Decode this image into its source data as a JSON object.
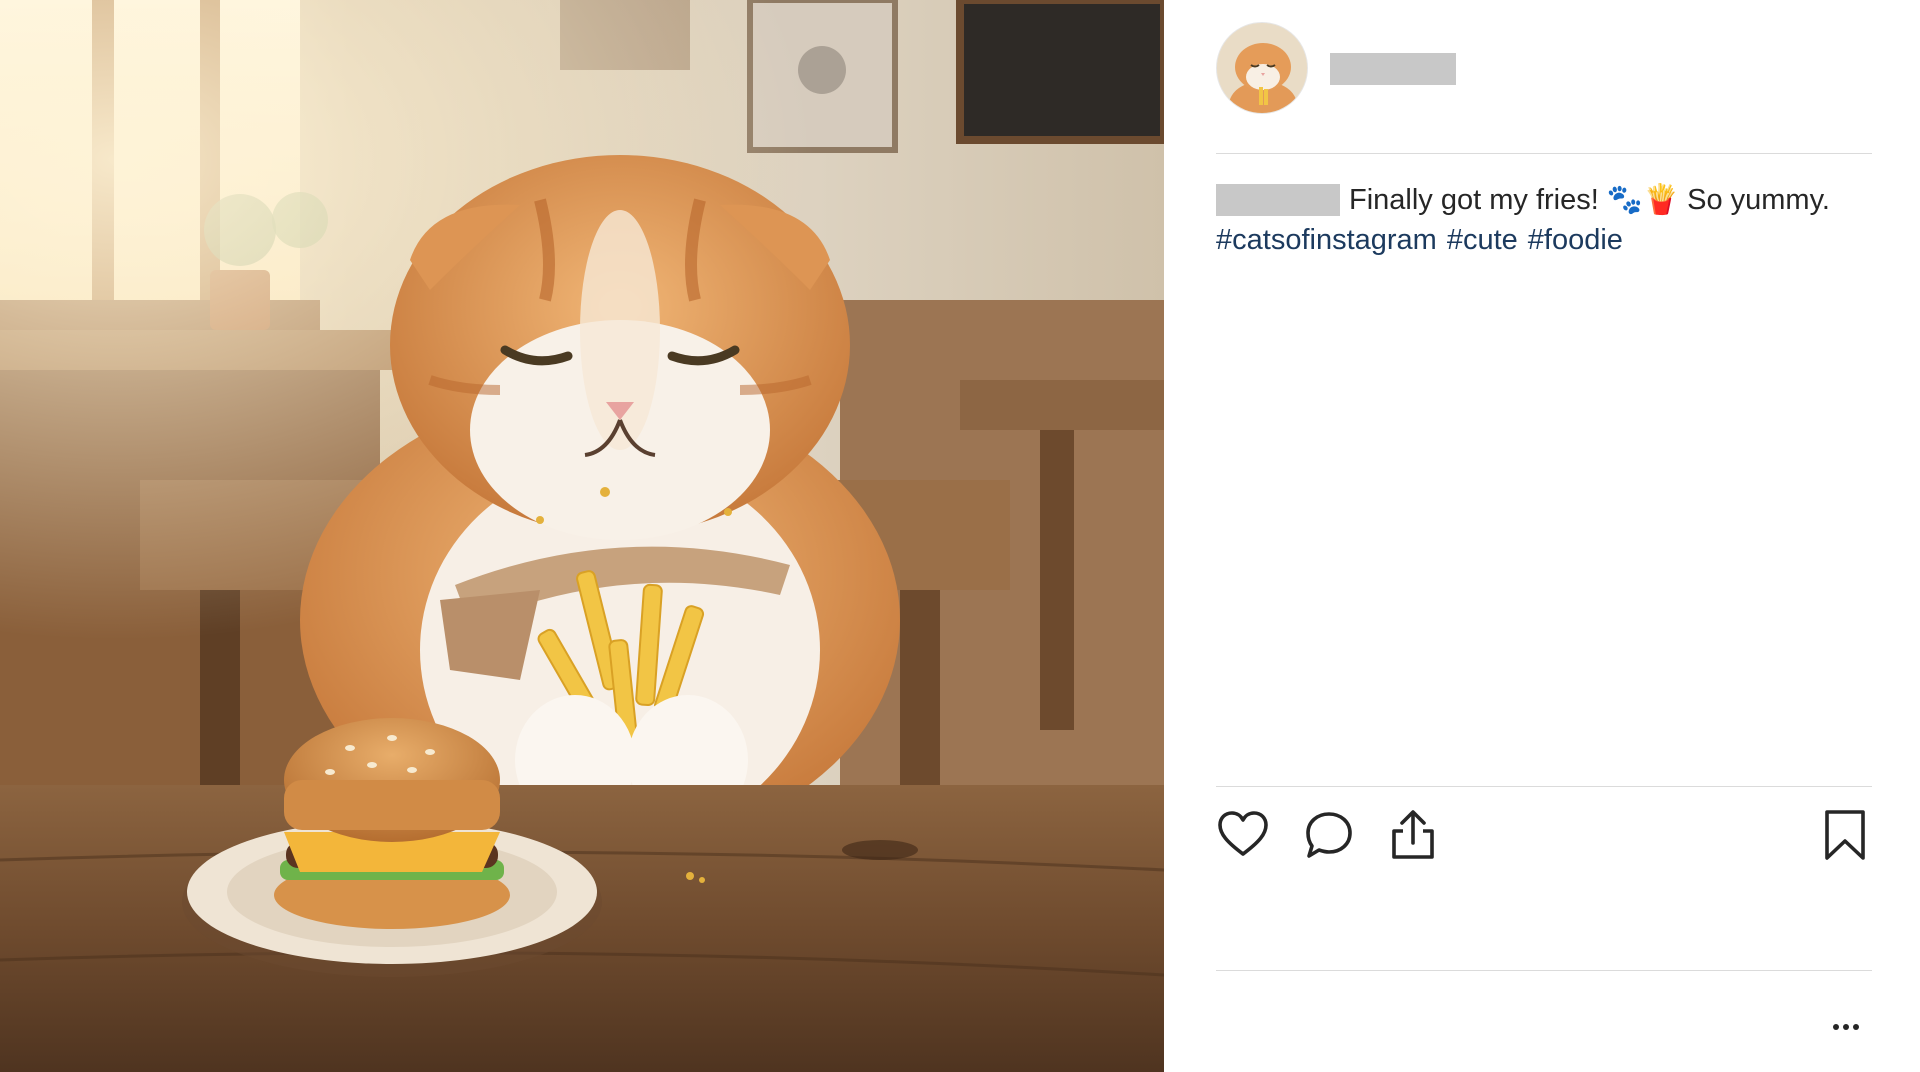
{
  "post": {
    "image_alt": "Orange and white cat at a cafe table holding french fries beside a small cheeseburger",
    "author": {
      "username": "",
      "username_redacted": true,
      "avatar_icon": "cat-avatar"
    },
    "caption": {
      "author_redacted": true,
      "text": "Finally got my fries! 🐾🍟 So yummy.",
      "hashtags": [
        "#catsofinstagram",
        "#cute",
        "#foodie"
      ]
    },
    "actions": {
      "like_icon": "heart-outline-icon",
      "comment_icon": "speech-bubble-icon",
      "share_icon": "share-upload-icon",
      "save_icon": "bookmark-outline-icon",
      "more_icon": "more-horizontal-icon"
    },
    "colors": {
      "hashtag": "#1c3a5e",
      "text": "#262626",
      "divider": "#dbdbdb",
      "redaction": "#c8c8c8"
    }
  }
}
